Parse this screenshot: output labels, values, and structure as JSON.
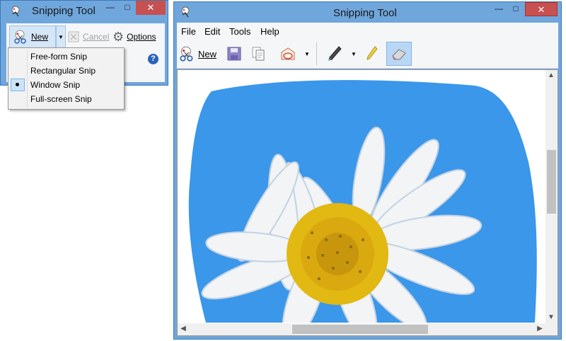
{
  "small_window": {
    "title": "Snipping Tool",
    "toolbar": {
      "new_label": "New",
      "cancel_label": "Cancel",
      "options_label": "Options"
    },
    "dropdown": {
      "items": [
        "Free-form Snip",
        "Rectangular Snip",
        "Window Snip",
        "Full-screen Snip"
      ],
      "selected": "Window Snip"
    }
  },
  "main_window": {
    "title": "Snipping Tool",
    "menu": [
      "File",
      "Edit",
      "Tools",
      "Help"
    ],
    "toolbar": {
      "new_label": "New"
    },
    "window_buttons": {
      "minimize": "—",
      "maximize": "□",
      "close": "✕"
    }
  },
  "colors": {
    "window_frame": "#6fa6dc",
    "close_button": "#c75050",
    "sky": "#3a97ea",
    "petal": "#f2f4f6",
    "flower_center": "#e2b812",
    "selected_item": "#cce4f7"
  }
}
